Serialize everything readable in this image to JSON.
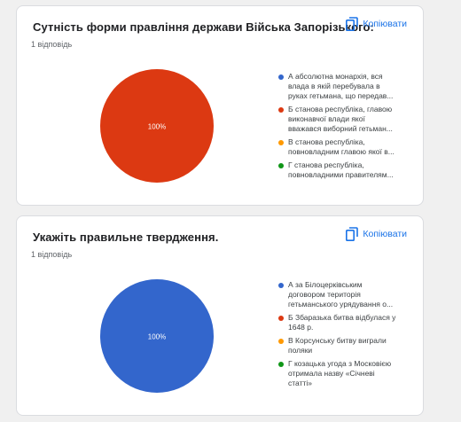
{
  "copy_label": "Копіювати",
  "colors": {
    "blue": "#3366cc",
    "red": "#dc3912",
    "orange": "#ff9900",
    "green": "#109618"
  },
  "questions": [
    {
      "title": "Сутність форми правління держави Війська Запорізького:",
      "responses": "1 відповідь",
      "pie_label": "100%",
      "legend": [
        {
          "lines": [
            "А абсолютна монархія, вся",
            "влада в якій перебувала в",
            "руках гетьмана, що передав..."
          ],
          "color": "#3366cc"
        },
        {
          "lines": [
            "Б станова республіка, главою",
            "виконавчої влади якої",
            "вважався виборний гетьман..."
          ],
          "color": "#dc3912"
        },
        {
          "lines": [
            "В станова республіка,",
            "повновладним главою якої в..."
          ],
          "color": "#ff9900"
        },
        {
          "lines": [
            "Г станова республіка,",
            "повновладними правителям..."
          ],
          "color": "#109618"
        }
      ],
      "chart_data": {
        "type": "pie",
        "categories": [
          "А",
          "Б",
          "В",
          "Г"
        ],
        "values": [
          0,
          100,
          0,
          0
        ],
        "colors": [
          "#3366cc",
          "#dc3912",
          "#ff9900",
          "#109618"
        ]
      }
    },
    {
      "title": "Укажіть правильне твердження.",
      "responses": "1 відповідь",
      "pie_label": "100%",
      "legend": [
        {
          "lines": [
            "А за Білоцерківським",
            "договором територія",
            "гетьманського урядування о..."
          ],
          "color": "#3366cc"
        },
        {
          "lines": [
            "Б Збаразька битва відбулася у",
            "1648 р."
          ],
          "color": "#dc3912"
        },
        {
          "lines": [
            "В Корсунську битву виграли",
            "поляки"
          ],
          "color": "#ff9900"
        },
        {
          "lines": [
            "Г козацька угода з Московією",
            "отримала назву «Січневі",
            "статті»"
          ],
          "color": "#109618"
        }
      ],
      "chart_data": {
        "type": "pie",
        "categories": [
          "А",
          "Б",
          "В",
          "Г"
        ],
        "values": [
          100,
          0,
          0,
          0
        ],
        "colors": [
          "#3366cc",
          "#dc3912",
          "#ff9900",
          "#109618"
        ]
      }
    }
  ]
}
